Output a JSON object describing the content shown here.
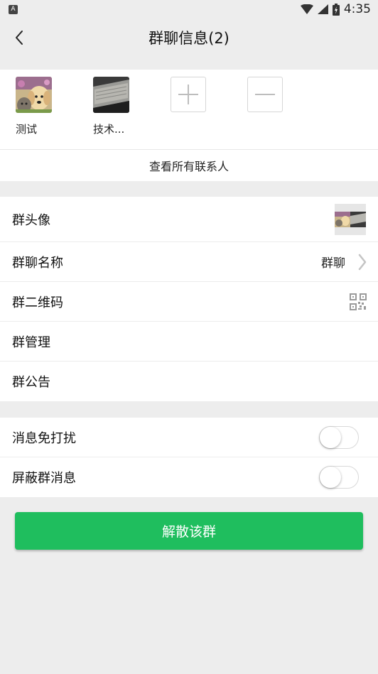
{
  "status_bar": {
    "time": "4:35",
    "notification_icon": "A"
  },
  "header": {
    "title": "群聊信息(2)",
    "back_icon": "chevron-left-icon"
  },
  "members": [
    {
      "name": "测试",
      "avatar": "puppy-kitten-photo"
    },
    {
      "name": "技术...",
      "avatar": "laptop-photo"
    }
  ],
  "member_actions": {
    "add_icon": "plus-icon",
    "remove_icon": "minus-icon"
  },
  "view_all_label": "查看所有联系人",
  "settings": {
    "group_avatar_label": "群头像",
    "group_name_label": "群聊名称",
    "group_name_value": "群聊",
    "qr_code_label": "群二维码",
    "manage_label": "群管理",
    "notice_label": "群公告"
  },
  "toggles": {
    "mute_label": "消息免打扰",
    "mute_on": false,
    "block_label": "屏蔽群消息",
    "block_on": false
  },
  "dissolve_button_label": "解散该群",
  "colors": {
    "accent": "#1fbe5e",
    "background": "#ededed"
  }
}
